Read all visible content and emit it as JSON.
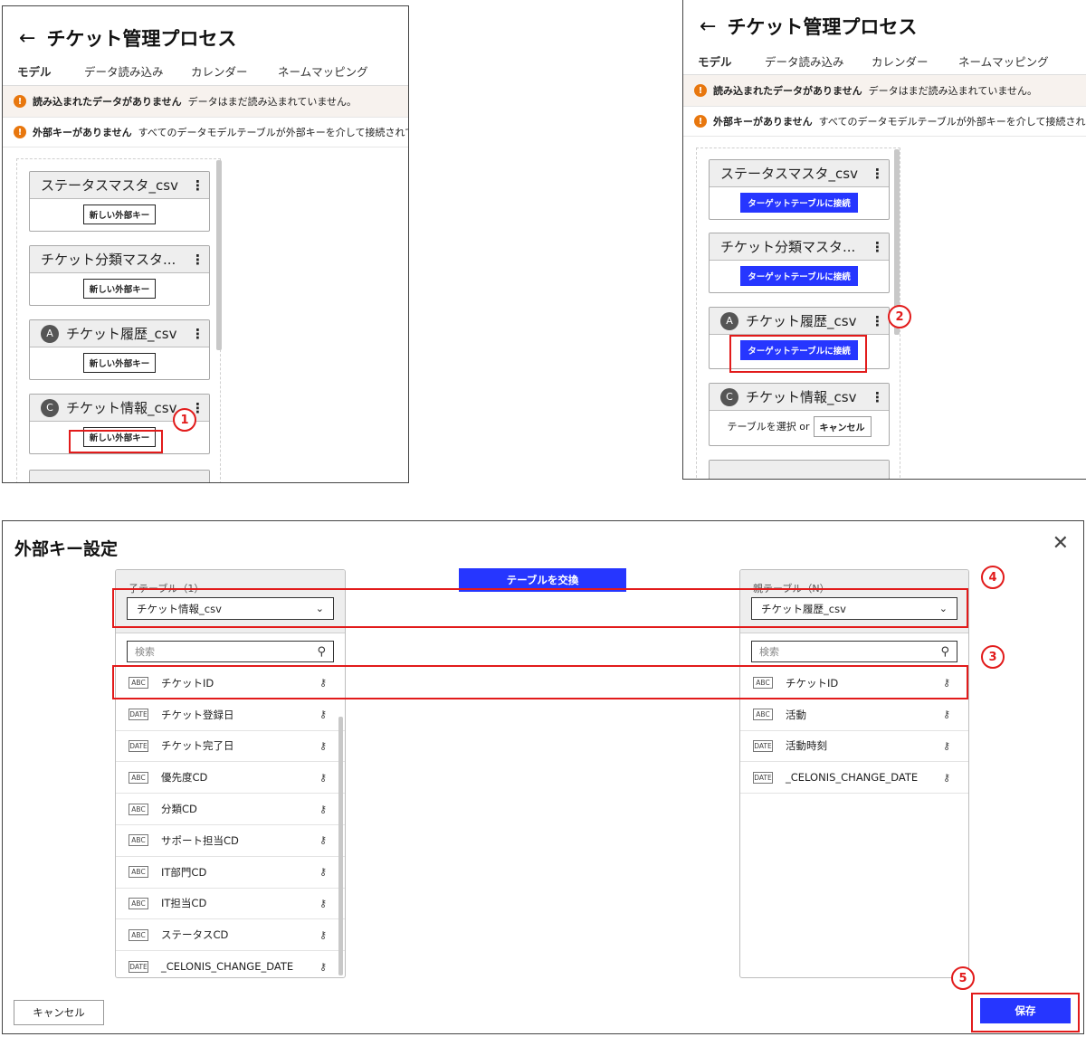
{
  "panel1": {
    "title": "チケット管理プロセス",
    "tabs": [
      "モデル",
      "データ読み込み",
      "カレンダー",
      "ネームマッピング"
    ],
    "warnings": [
      {
        "title": "読み込まれたデータがありません",
        "text": "データはまだ読み込まれていません。"
      },
      {
        "title": "外部キーがありません",
        "text": "すべてのデータモデルテーブルが外部キーを介して接続されてい"
      }
    ],
    "cards": [
      {
        "name": "ステータスマスタ_csv",
        "badge": "",
        "action": "新しい外部キー"
      },
      {
        "name": "チケット分類マスタ...",
        "badge": "",
        "action": "新しい外部キー"
      },
      {
        "name": "チケット履歴_csv",
        "badge": "A",
        "action": "新しい外部キー"
      },
      {
        "name": "チケット情報_csv",
        "badge": "C",
        "action": "新しい外部キー"
      }
    ],
    "marker": "1"
  },
  "panel2": {
    "title": "チケット管理プロセス",
    "tabs": [
      "モデル",
      "データ読み込み",
      "カレンダー",
      "ネームマッピング"
    ],
    "warnings": [
      {
        "title": "読み込まれたデータがありません",
        "text": "データはまだ読み込まれていません。"
      },
      {
        "title": "外部キーがありません",
        "text": "すべてのデータモデルテーブルが外部キーを介して接続されて"
      }
    ],
    "cards": [
      {
        "name": "ステータスマスタ_csv",
        "badge": "",
        "action": "ターゲットテーブルに接続"
      },
      {
        "name": "チケット分類マスタ...",
        "badge": "",
        "action": "ターゲットテーブルに接続"
      },
      {
        "name": "チケット履歴_csv",
        "badge": "A",
        "action": "ターゲットテーブルに接続"
      },
      {
        "name": "チケット情報_csv",
        "badge": "C",
        "select_text": "テーブルを選択 or",
        "cancel_label": "キャンセル"
      }
    ],
    "marker": "2"
  },
  "dialog": {
    "title": "外部キー設定",
    "swap_label": "テーブルを交換",
    "child": {
      "label": "子テーブル（1）",
      "selected": "チケット情報_csv",
      "search_placeholder": "検索",
      "fields": [
        {
          "type": "ABC",
          "name": "チケットID"
        },
        {
          "type": "DATE",
          "name": "チケット登録日"
        },
        {
          "type": "DATE",
          "name": "チケット完了日"
        },
        {
          "type": "ABC",
          "name": "優先度CD"
        },
        {
          "type": "ABC",
          "name": "分類CD"
        },
        {
          "type": "ABC",
          "name": "サポート担当CD"
        },
        {
          "type": "ABC",
          "name": "IT部門CD"
        },
        {
          "type": "ABC",
          "name": "IT担当CD"
        },
        {
          "type": "ABC",
          "name": "ステータスCD"
        },
        {
          "type": "DATE",
          "name": "_CELONIS_CHANGE_DATE"
        }
      ]
    },
    "parent": {
      "label": "親テーブル（N）",
      "selected": "チケット履歴_csv",
      "search_placeholder": "検索",
      "fields": [
        {
          "type": "ABC",
          "name": "チケットID"
        },
        {
          "type": "ABC",
          "name": "活動"
        },
        {
          "type": "DATE",
          "name": "活動時刻"
        },
        {
          "type": "DATE",
          "name": "_CELONIS_CHANGE_DATE"
        }
      ]
    },
    "cancel_label": "キャンセル",
    "save_label": "保存",
    "markers": [
      "3",
      "4",
      "5"
    ]
  },
  "icons": {
    "back": "←",
    "dots": "⋮",
    "caret": "⌄",
    "search": "⚲",
    "key": "⚷",
    "close": "✕",
    "warn": "!"
  },
  "colors": {
    "accent": "#2636ff",
    "warning": "#e8770e",
    "highlight": "#e21b1b"
  }
}
